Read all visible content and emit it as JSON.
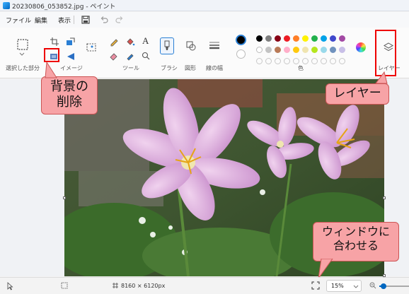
{
  "window": {
    "title": "20230806_053852.jpg - ペイント"
  },
  "menu": {
    "file": "ファイル",
    "edit": "編集",
    "view": "表示"
  },
  "ribbon": {
    "groups": {
      "selection": "選択した部分",
      "image": "イメージ",
      "tools": "ツール",
      "brushes": "ブラシ",
      "shapes": "図形",
      "line_width": "線の幅",
      "colors": "色",
      "layers": "レイヤー"
    },
    "text_tool_glyph": "A",
    "primary_color": "#000000",
    "secondary_color": "#ffffff",
    "palette_row1": [
      "#000000",
      "#7f7f7f",
      "#880015",
      "#ed1c24",
      "#ff7f27",
      "#fff200",
      "#22b14c",
      "#00a2e8",
      "#3f48cc",
      "#a349a4"
    ],
    "palette_row2": [
      "#ffffff",
      "#c3c3c3",
      "#b97a57",
      "#ffaec9",
      "#ffc90e",
      "#efe4b0",
      "#b5e61d",
      "#99d9ea",
      "#7092be",
      "#c8bfe7"
    ]
  },
  "annotations": {
    "background_removal_callout": "背景の\n削除",
    "layers_callout": "レイヤー",
    "fit_window_callout": "ウィンドウに\n合わせる"
  },
  "status": {
    "image_size": "8160 × 6120px",
    "zoom": "15%"
  }
}
